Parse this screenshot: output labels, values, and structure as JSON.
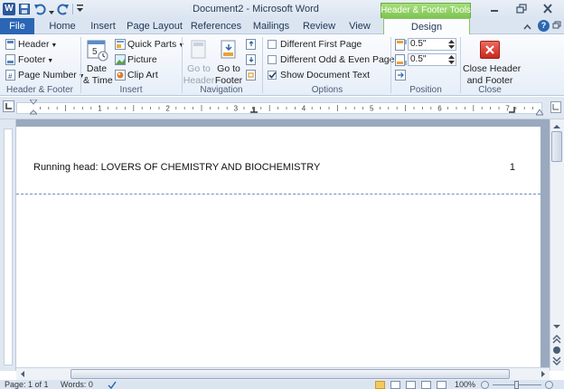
{
  "window": {
    "title": "Document2 - Microsoft Word",
    "contextual_tab_group": "Header & Footer Tools",
    "controls": [
      "minimize",
      "restore",
      "close"
    ]
  },
  "quick_access": {
    "app_icon": "word-app-icon",
    "items": [
      "save-icon",
      "undo-icon",
      "redo-icon",
      "customize-qat-icon"
    ]
  },
  "tabs": [
    {
      "label": "File",
      "active": false
    },
    {
      "label": "Home",
      "active": false
    },
    {
      "label": "Insert",
      "active": false
    },
    {
      "label": "Page Layout",
      "active": false
    },
    {
      "label": "References",
      "active": false
    },
    {
      "label": "Mailings",
      "active": false
    },
    {
      "label": "Review",
      "active": false
    },
    {
      "label": "View",
      "active": false
    },
    {
      "label": "Design",
      "active": true
    }
  ],
  "ribbon": {
    "groups": {
      "header_footer": {
        "label": "Header & Footer",
        "header": "Header",
        "footer": "Footer",
        "page_number": "Page Number"
      },
      "insert": {
        "label": "Insert",
        "date_time_line1": "Date",
        "date_time_line2": "& Time",
        "quick_parts": "Quick Parts",
        "picture": "Picture",
        "clip_art": "Clip Art"
      },
      "navigation": {
        "label": "Navigation",
        "go_to_header_line1": "Go to",
        "go_to_header_line2": "Header",
        "go_to_footer_line1": "Go to",
        "go_to_footer_line2": "Footer"
      },
      "options": {
        "label": "Options",
        "different_first_page": {
          "label": "Different First Page",
          "checked": false
        },
        "different_odd_even": {
          "label": "Different Odd & Even Pages",
          "checked": false
        },
        "show_document_text": {
          "label": "Show Document Text",
          "checked": true
        }
      },
      "position": {
        "label": "Position",
        "header_from_top": "0.5\"",
        "footer_from_bottom": "0.5\""
      },
      "close": {
        "label": "Close",
        "button_line1": "Close Header",
        "button_line2": "and Footer"
      }
    }
  },
  "document": {
    "header_text": "Running head: LOVERS OF CHEMISTRY AND BIOCHEMISTRY",
    "page_number": "1"
  },
  "status_bar": {
    "page": "Page: 1 of 1",
    "words": "Words: 0",
    "zoom": "100%"
  },
  "colors": {
    "accent": "#2b579a",
    "file_tab": "#2a66b5",
    "contextual_green": "#7cc452",
    "workspace": "#9aa9bd",
    "close_red": "#d9332b"
  }
}
